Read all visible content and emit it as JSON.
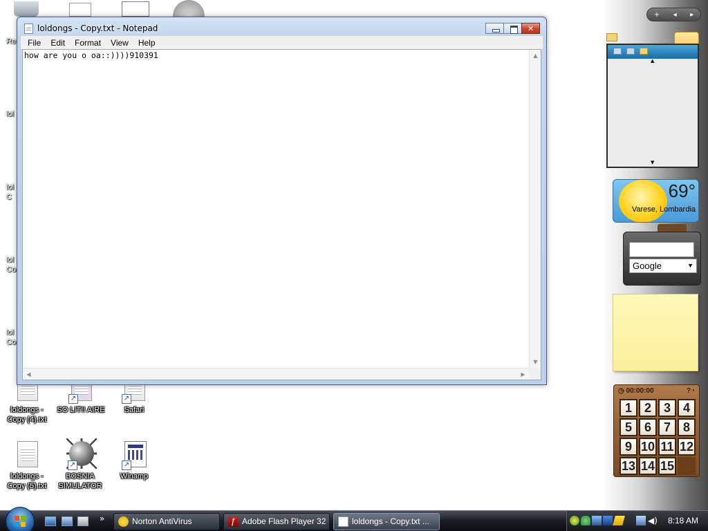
{
  "notepad": {
    "title": "loldongs - Copy.txt - Notepad",
    "menu": [
      "File",
      "Edit",
      "Format",
      "View",
      "Help"
    ],
    "content": "how are you o oa::))))910391"
  },
  "desktop": {
    "partial_labels": [
      "Re",
      "lol",
      "lol\nC",
      "lol\nCo",
      "lol\nCo"
    ],
    "icons": [
      {
        "label": "loldongs - Copy (4).txt",
        "icon": "text-document-icon"
      },
      {
        "label": "SO LIT!! AIRE",
        "icon": "shortcut-icon"
      },
      {
        "label": "Safari",
        "icon": "safari-shortcut-icon"
      },
      {
        "label": "loldongs - Copy (5).txt",
        "icon": "text-document-icon"
      },
      {
        "label": "BOSNIA SIMULATOR",
        "icon": "minesweeper-icon"
      },
      {
        "label": "Winamp",
        "icon": "winamp-icon"
      }
    ]
  },
  "sidebar": {
    "controls": [
      "+",
      "◂",
      "▸"
    ],
    "weather": {
      "temperature": "69°",
      "location": "Varese, Lombardia"
    },
    "google": {
      "search_value": "",
      "engine": "Google"
    },
    "puzzle": {
      "timer": "00:00:00",
      "tiles": [
        "1",
        "2",
        "3",
        "4",
        "5",
        "6",
        "7",
        "8",
        "9",
        "10",
        "11",
        "12",
        "13",
        "14",
        "15",
        ""
      ]
    }
  },
  "taskbar": {
    "buttons": [
      {
        "label": "Norton AntiVirus",
        "icon": "norton-icon",
        "active": false
      },
      {
        "label": "Adobe Flash Player 32",
        "icon": "flash-player-icon",
        "active": false
      },
      {
        "label": "loldongs - Copy.txt ...",
        "icon": "notepad-icon",
        "active": true
      }
    ],
    "clock": "8:18 AM"
  },
  "colors": {
    "taskbar": "#1a1d22",
    "window_frame": "#c2d5ec",
    "close_button": "#c94a32",
    "note": "#fff9b8"
  }
}
